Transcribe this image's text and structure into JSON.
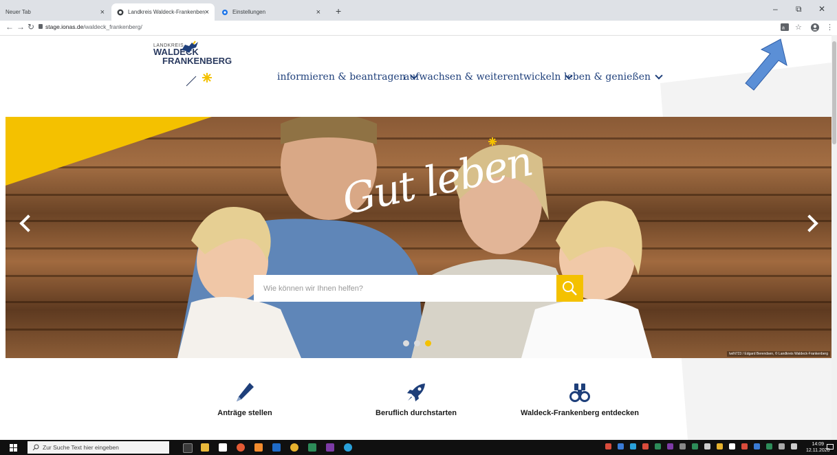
{
  "browser": {
    "tabs": [
      {
        "title": "Neuer Tab",
        "active": false
      },
      {
        "title": "Landkreis Waldeck-Frankenberg",
        "active": true
      },
      {
        "title": "Einstellungen",
        "active": false
      }
    ],
    "new_tab_glyph": "+",
    "close_glyph": "×",
    "url_host": "stage.ionas.de",
    "url_path": "/waldeck_frankenberg/",
    "win_min": "–",
    "win_restore": "⧉",
    "win_close": "✕"
  },
  "site": {
    "logo": {
      "line1": "LANDKREIS",
      "line2": "WALDECK",
      "line3": "FRANKENBERG"
    },
    "nav": [
      {
        "label": "informieren & beantragen"
      },
      {
        "label": "aufwachsen & weiterentwickeln"
      },
      {
        "label": "leben & genießen"
      }
    ],
    "hero": {
      "script_text": "Gut leben",
      "search_placeholder": "Wie können wir Ihnen helfen?",
      "slides": 3,
      "active_slide": 3,
      "credit": "twiN723 / Edgard Berendsen, © Landkreis Waldeck-Frankenberg"
    },
    "features": [
      {
        "label": "Anträge stellen",
        "icon": "pencil-icon"
      },
      {
        "label": "Beruflich durchstarten",
        "icon": "rocket-icon"
      },
      {
        "label": "Waldeck-Frankenberg entdecken",
        "icon": "binoculars-icon"
      }
    ]
  },
  "taskbar": {
    "search_placeholder": "Zur Suche Text hier eingeben",
    "time": "14:09",
    "date": "12.11.2020"
  },
  "colors": {
    "brand_yellow": "#f4c100",
    "brand_blue": "#1e3f7a",
    "annotation_arrow": "#5b8fd6"
  }
}
